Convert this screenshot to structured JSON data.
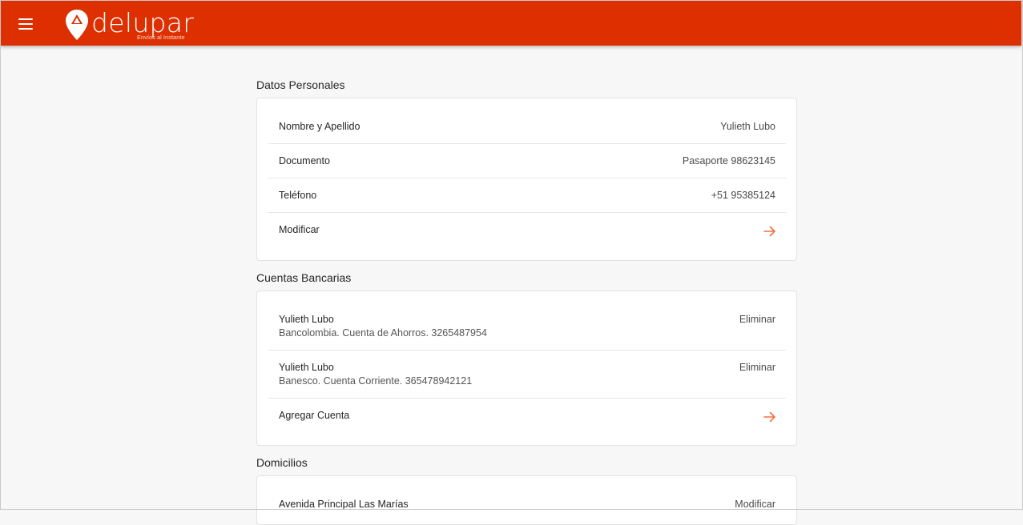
{
  "header": {
    "brand": "delupar",
    "tagline": "Envíos al Instante",
    "menu_icon": "hamburger-icon",
    "bar_color": "#dd2f00"
  },
  "personal": {
    "title": "Datos Personales",
    "rows": [
      {
        "label": "Nombre y Apellido",
        "value": "Yulieth Lubo"
      },
      {
        "label": "Documento",
        "value": "Pasaporte 98623145"
      },
      {
        "label": "Teléfono",
        "value": "+51 95385124"
      }
    ],
    "action": "Modificar"
  },
  "banks": {
    "title": "Cuentas Bancarias",
    "accounts": [
      {
        "name": "Yulieth Lubo",
        "detail": "Bancolombia. Cuenta de Ahorros. 3265487954",
        "action": "Eliminar"
      },
      {
        "name": "Yulieth Lubo",
        "detail": "Banesco. Cuenta Corriente. 365478942121",
        "action": "Eliminar"
      }
    ],
    "add_action": "Agregar Cuenta"
  },
  "addresses": {
    "title": "Domicilios",
    "items": [
      {
        "address": "Avenida Principal Las Marías",
        "action": "Modificar"
      }
    ]
  },
  "colors": {
    "accent": "#f07040"
  }
}
